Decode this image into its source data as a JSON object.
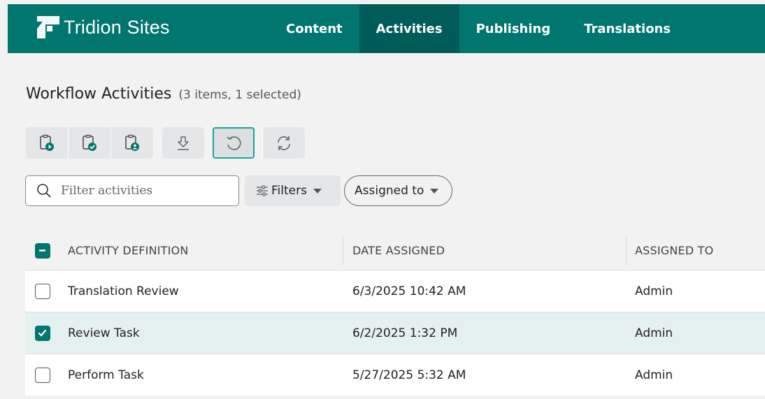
{
  "app": {
    "brand": "Tridion Sites"
  },
  "nav": [
    {
      "label": "Content",
      "active": false
    },
    {
      "label": "Activities",
      "active": true
    },
    {
      "label": "Publishing",
      "active": false
    },
    {
      "label": "Translations",
      "active": false
    }
  ],
  "page": {
    "title": "Workflow Activities",
    "count": "(3 items, 1 selected)"
  },
  "toolbar": {
    "icons": [
      "start-activity-icon",
      "finish-activity-icon",
      "reassign-activity-icon",
      "download-icon",
      "undo-icon",
      "refresh-icon"
    ]
  },
  "search": {
    "placeholder": "Filter activities",
    "value": ""
  },
  "filters": {
    "label": "Filters",
    "assigned_label": "Assigned to"
  },
  "table": {
    "columns": [
      "ACTIVITY DEFINITION",
      "DATE ASSIGNED",
      "ASSIGNED TO"
    ],
    "rows": [
      {
        "activity": "Translation Review",
        "date": "6/3/2025 10:42 AM",
        "assigned": "Admin",
        "selected": false
      },
      {
        "activity": "Review Task",
        "date": "6/2/2025 1:32 PM",
        "assigned": "Admin",
        "selected": true
      },
      {
        "activity": "Perform Task",
        "date": "5/27/2025 5:32 AM",
        "assigned": "Admin",
        "selected": false
      }
    ]
  },
  "colors": {
    "brand": "#00766f",
    "brand_dark": "#005c58",
    "selected_row": "#e5f1f0",
    "accent": "#1aa39a"
  }
}
